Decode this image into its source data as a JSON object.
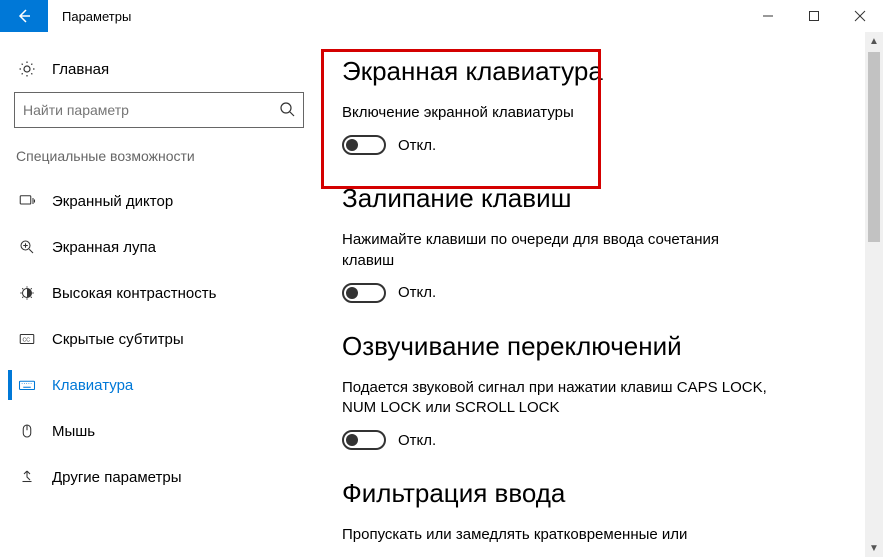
{
  "window": {
    "title": "Параметры"
  },
  "sidebar": {
    "home_label": "Главная",
    "search_placeholder": "Найти параметр",
    "section_label": "Специальные возможности",
    "items": [
      {
        "label": "Экранный диктор"
      },
      {
        "label": "Экранная лупа"
      },
      {
        "label": "Высокая контрастность"
      },
      {
        "label": "Скрытые субтитры"
      },
      {
        "label": "Клавиатура"
      },
      {
        "label": "Мышь"
      },
      {
        "label": "Другие параметры"
      }
    ]
  },
  "main": {
    "sections": [
      {
        "heading": "Экранная клавиатура",
        "desc": "Включение экранной клавиатуры",
        "toggle_state": "Откл."
      },
      {
        "heading": "Залипание клавиш",
        "desc": "Нажимайте клавиши по очереди для ввода сочетания клавиш",
        "toggle_state": "Откл."
      },
      {
        "heading": "Озвучивание переключений",
        "desc": "Подается звуковой сигнал при нажатии клавиш CAPS LOCK, NUM LOCK или SCROLL LOCK",
        "toggle_state": "Откл."
      },
      {
        "heading": "Фильтрация ввода",
        "desc": "Пропускать или замедлять кратковременные или"
      }
    ]
  }
}
